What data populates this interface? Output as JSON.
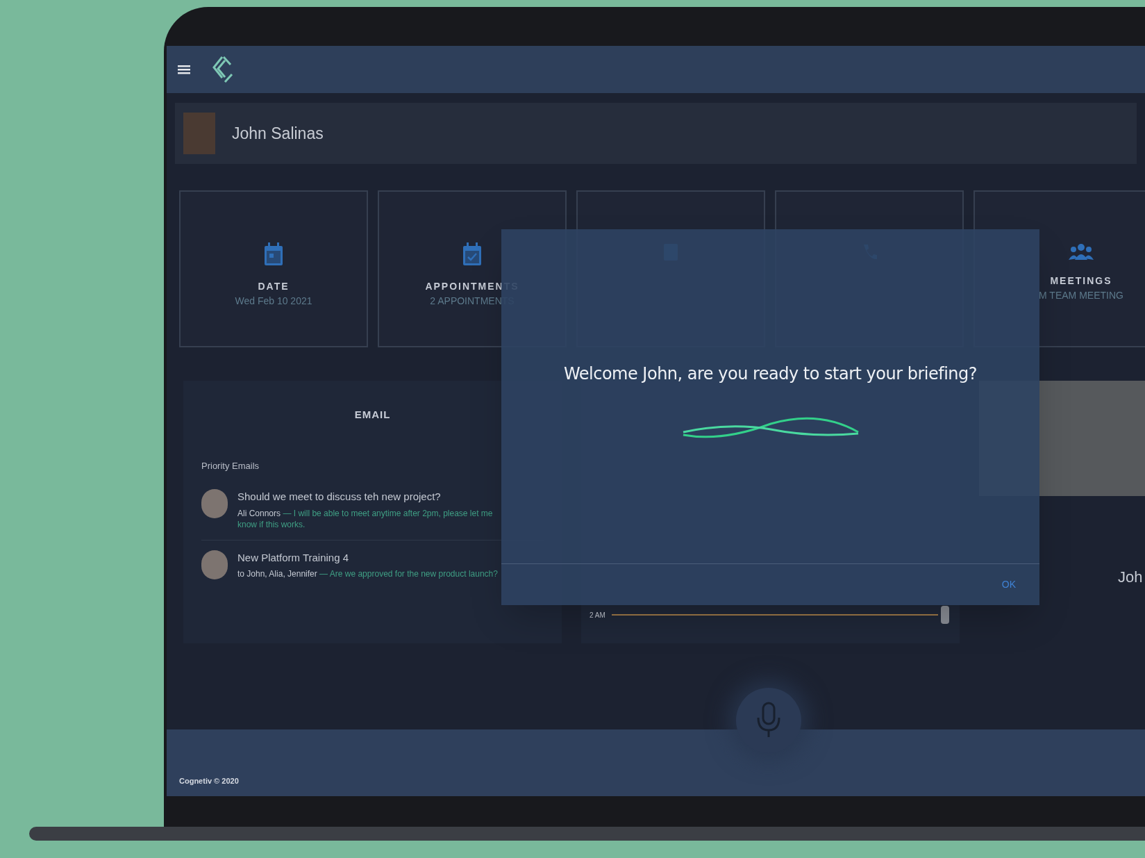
{
  "profile": {
    "name": "John Salinas"
  },
  "cards": [
    {
      "kind": "date",
      "title": "DATE",
      "value": "Wed Feb 10 2021"
    },
    {
      "kind": "appointments",
      "title": "APPOINTMENTS",
      "value": "2 APPOINTMENTS"
    },
    {
      "kind": "tasks"
    },
    {
      "kind": "calls"
    },
    {
      "kind": "meetings",
      "title": "MEETINGS",
      "value": "M TEAM MEETING"
    }
  ],
  "email": {
    "title": "EMAIL",
    "section": "Priority Emails",
    "items": [
      {
        "subject": "Should we meet to discuss teh new project?",
        "from": "Ali Connors",
        "snippet": "— I will be able to meet anytime after 2pm, please let me know if this works."
      },
      {
        "subject": "New Platform Training 4",
        "from": "to John, Alia, Jennifer",
        "snippet": "— Are we approved for the new product launch?"
      }
    ]
  },
  "schedule": {
    "tick": "2 AM"
  },
  "contact": {
    "name": "Joh"
  },
  "dialog": {
    "message": "Welcome John, are you ready to start your briefing?",
    "button": "OK"
  },
  "footer": {
    "text": "Cognetiv © 2020"
  }
}
